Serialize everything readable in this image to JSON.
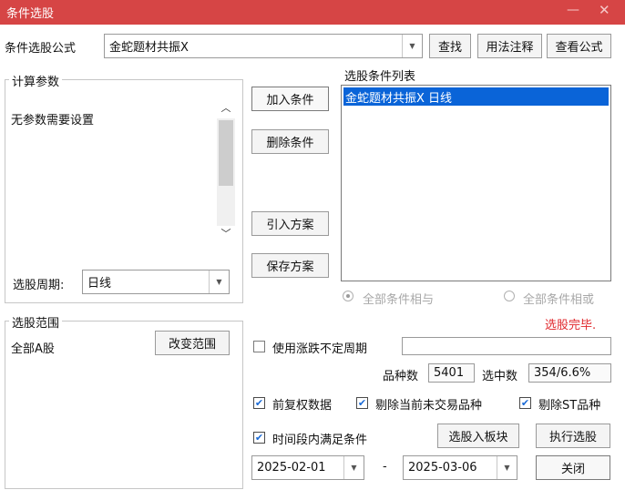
{
  "window": {
    "title": "条件选股",
    "minimize_glyph": "—",
    "close_glyph": "✕"
  },
  "formula": {
    "label": "条件选股公式",
    "value": "金蛇题材共振X",
    "find_button": "查找",
    "usage_button": "用法注释",
    "view_button": "查看公式"
  },
  "params": {
    "legend": "计算参数",
    "text": "无参数需要设置",
    "period_label": "选股周期:",
    "period_value": "日线"
  },
  "actions": {
    "add": "加入条件",
    "delete": "删除条件",
    "import": "引入方案",
    "save": "保存方案"
  },
  "conditions": {
    "label": "选股条件列表",
    "items": [
      "金蛇题材共振X  日线"
    ]
  },
  "logic": {
    "all_and": "全部条件相与",
    "all_or": "全部条件相或",
    "selected": "all_and"
  },
  "status": {
    "text": "选股完毕.",
    "color": "#e0282c"
  },
  "range": {
    "legend": "选股范围",
    "value": "全部A股",
    "change_button": "改变范围"
  },
  "options": {
    "variable_period": {
      "label": "使用涨跌不定周期",
      "checked": false,
      "value": ""
    },
    "pre_adjust": {
      "label": "前复权数据",
      "checked": true
    },
    "exclude_untraded": {
      "label": "剔除当前未交易品种",
      "checked": true
    },
    "exclude_st": {
      "label": "剔除ST品种",
      "checked": true
    },
    "time_range": {
      "label": "时间段内满足条件",
      "checked": true
    }
  },
  "stats": {
    "count_label": "品种数",
    "count_value": "5401",
    "selected_label": "选中数",
    "selected_value": "354/6.6%"
  },
  "dates": {
    "start": "2025-02-01",
    "separator": "-",
    "end": "2025-03-06"
  },
  "buttons": {
    "to_block": "选股入板块",
    "execute": "执行选股",
    "close": "关闭"
  },
  "icons": {
    "dropdown": "chevron-down-icon",
    "scroll_up": "chevron-up-icon",
    "scroll_down": "chevron-down-icon",
    "check": "✔"
  }
}
